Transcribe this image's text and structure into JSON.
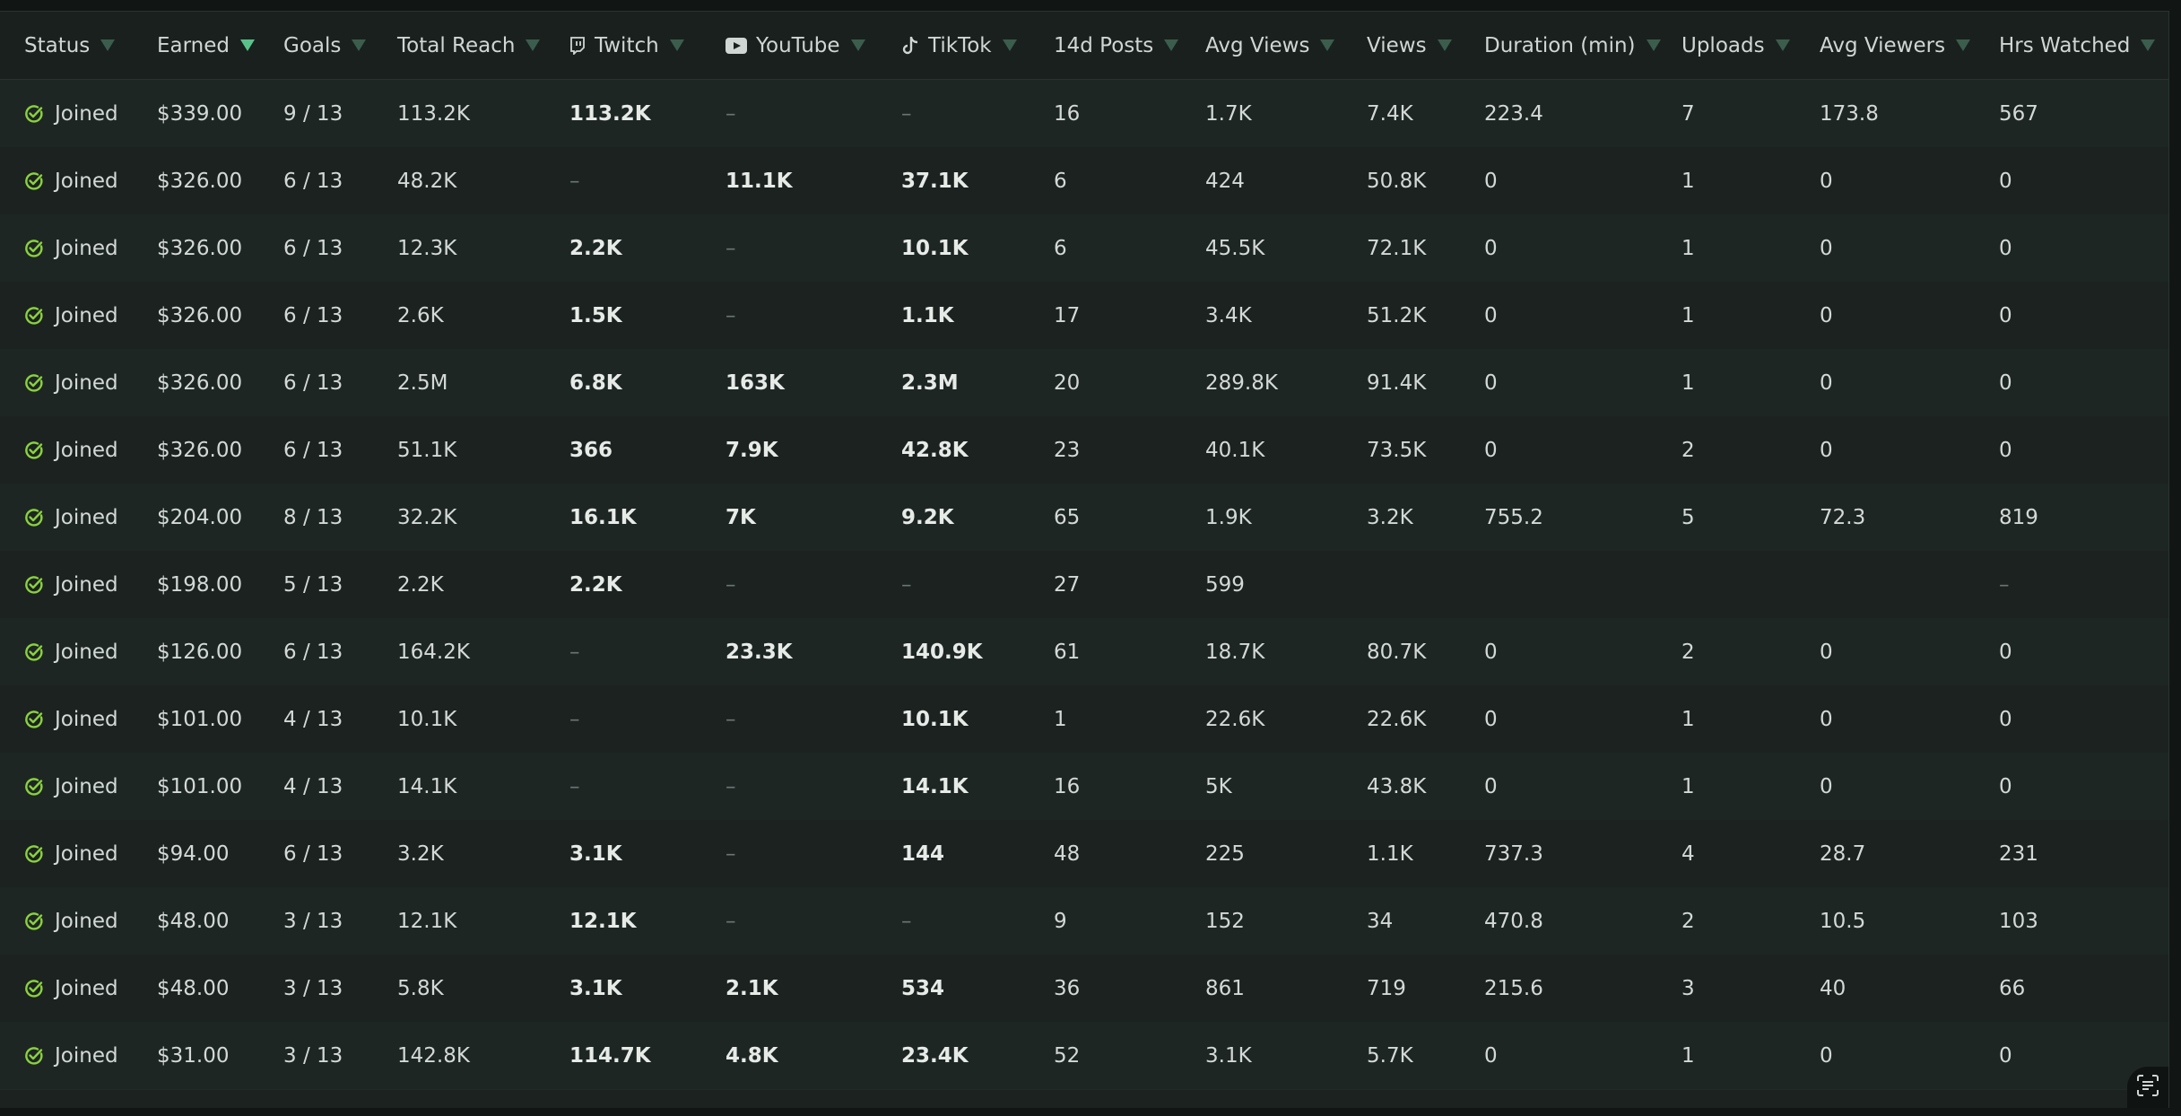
{
  "colors": {
    "background": "#1b2220",
    "accent_green": "#8ad13f",
    "sort_arrow": "#3b5d4e",
    "sort_arrow_active": "#59c28b",
    "dash": "#6b7673"
  },
  "columns": [
    {
      "key": "status",
      "label": "Status",
      "sort_icon": "sort-arrow-icon"
    },
    {
      "key": "earned",
      "label": "Earned",
      "sort_icon": "sort-arrow-icon",
      "active": true
    },
    {
      "key": "goals",
      "label": "Goals",
      "sort_icon": "sort-arrow-icon"
    },
    {
      "key": "total_reach",
      "label": "Total Reach",
      "sort_icon": "sort-arrow-icon"
    },
    {
      "key": "twitch",
      "label": "Twitch",
      "sort_icon": "sort-arrow-icon",
      "platform_icon": "twitch-icon"
    },
    {
      "key": "youtube",
      "label": "YouTube",
      "sort_icon": "sort-arrow-icon",
      "platform_icon": "youtube-icon"
    },
    {
      "key": "tiktok",
      "label": "TikTok",
      "sort_icon": "sort-arrow-icon",
      "platform_icon": "tiktok-icon"
    },
    {
      "key": "posts14",
      "label": "14d Posts",
      "sort_icon": "sort-arrow-icon"
    },
    {
      "key": "avg_views",
      "label": "Avg Views",
      "sort_icon": "sort-arrow-icon"
    },
    {
      "key": "views",
      "label": "Views",
      "sort_icon": "sort-arrow-icon"
    },
    {
      "key": "duration",
      "label": "Duration (min)",
      "sort_icon": "sort-arrow-icon"
    },
    {
      "key": "uploads",
      "label": "Uploads",
      "sort_icon": "sort-arrow-icon"
    },
    {
      "key": "avg_viewers",
      "label": "Avg Viewers",
      "sort_icon": "sort-arrow-icon"
    },
    {
      "key": "hrs_watched",
      "label": "Hrs Watched",
      "sort_icon": "sort-arrow-icon"
    }
  ],
  "rows": [
    {
      "status": "Joined",
      "earned": "$339.00",
      "goals": "9 / 13",
      "total_reach": "113.2K",
      "twitch": "113.2K",
      "youtube": "–",
      "tiktok": "–",
      "posts14": "16",
      "avg_views": "1.7K",
      "views": "7.4K",
      "duration": "223.4",
      "uploads": "7",
      "avg_viewers": "173.8",
      "hrs_watched": "567"
    },
    {
      "status": "Joined",
      "earned": "$326.00",
      "goals": "6 / 13",
      "total_reach": "48.2K",
      "twitch": "–",
      "youtube": "11.1K",
      "tiktok": "37.1K",
      "posts14": "6",
      "avg_views": "424",
      "views": "50.8K",
      "duration": "0",
      "uploads": "1",
      "avg_viewers": "0",
      "hrs_watched": "0"
    },
    {
      "status": "Joined",
      "earned": "$326.00",
      "goals": "6 / 13",
      "total_reach": "12.3K",
      "twitch": "2.2K",
      "youtube": "–",
      "tiktok": "10.1K",
      "posts14": "6",
      "avg_views": "45.5K",
      "views": "72.1K",
      "duration": "0",
      "uploads": "1",
      "avg_viewers": "0",
      "hrs_watched": "0"
    },
    {
      "status": "Joined",
      "earned": "$326.00",
      "goals": "6 / 13",
      "total_reach": "2.6K",
      "twitch": "1.5K",
      "youtube": "–",
      "tiktok": "1.1K",
      "posts14": "17",
      "avg_views": "3.4K",
      "views": "51.2K",
      "duration": "0",
      "uploads": "1",
      "avg_viewers": "0",
      "hrs_watched": "0"
    },
    {
      "status": "Joined",
      "earned": "$326.00",
      "goals": "6 / 13",
      "total_reach": "2.5M",
      "twitch": "6.8K",
      "youtube": "163K",
      "tiktok": "2.3M",
      "posts14": "20",
      "avg_views": "289.8K",
      "views": "91.4K",
      "duration": "0",
      "uploads": "1",
      "avg_viewers": "0",
      "hrs_watched": "0"
    },
    {
      "status": "Joined",
      "earned": "$326.00",
      "goals": "6 / 13",
      "total_reach": "51.1K",
      "twitch": "366",
      "youtube": "7.9K",
      "tiktok": "42.8K",
      "posts14": "23",
      "avg_views": "40.1K",
      "views": "73.5K",
      "duration": "0",
      "uploads": "2",
      "avg_viewers": "0",
      "hrs_watched": "0"
    },
    {
      "status": "Joined",
      "earned": "$204.00",
      "goals": "8 / 13",
      "total_reach": "32.2K",
      "twitch": "16.1K",
      "youtube": "7K",
      "tiktok": "9.2K",
      "posts14": "65",
      "avg_views": "1.9K",
      "views": "3.2K",
      "duration": "755.2",
      "uploads": "5",
      "avg_viewers": "72.3",
      "hrs_watched": "819"
    },
    {
      "status": "Joined",
      "earned": "$198.00",
      "goals": "5 / 13",
      "total_reach": "2.2K",
      "twitch": "2.2K",
      "youtube": "–",
      "tiktok": "–",
      "posts14": "27",
      "avg_views": "599",
      "views": "",
      "duration": "",
      "uploads": "",
      "avg_viewers": "",
      "hrs_watched": "–"
    },
    {
      "status": "Joined",
      "earned": "$126.00",
      "goals": "6 / 13",
      "total_reach": "164.2K",
      "twitch": "–",
      "youtube": "23.3K",
      "tiktok": "140.9K",
      "posts14": "61",
      "avg_views": "18.7K",
      "views": "80.7K",
      "duration": "0",
      "uploads": "2",
      "avg_viewers": "0",
      "hrs_watched": "0"
    },
    {
      "status": "Joined",
      "earned": "$101.00",
      "goals": "4 / 13",
      "total_reach": "10.1K",
      "twitch": "–",
      "youtube": "–",
      "tiktok": "10.1K",
      "posts14": "1",
      "avg_views": "22.6K",
      "views": "22.6K",
      "duration": "0",
      "uploads": "1",
      "avg_viewers": "0",
      "hrs_watched": "0"
    },
    {
      "status": "Joined",
      "earned": "$101.00",
      "goals": "4 / 13",
      "total_reach": "14.1K",
      "twitch": "–",
      "youtube": "–",
      "tiktok": "14.1K",
      "posts14": "16",
      "avg_views": "5K",
      "views": "43.8K",
      "duration": "0",
      "uploads": "1",
      "avg_viewers": "0",
      "hrs_watched": "0"
    },
    {
      "status": "Joined",
      "earned": "$94.00",
      "goals": "6 / 13",
      "total_reach": "3.2K",
      "twitch": "3.1K",
      "youtube": "–",
      "tiktok": "144",
      "posts14": "48",
      "avg_views": "225",
      "views": "1.1K",
      "duration": "737.3",
      "uploads": "4",
      "avg_viewers": "28.7",
      "hrs_watched": "231"
    },
    {
      "status": "Joined",
      "earned": "$48.00",
      "goals": "3 / 13",
      "total_reach": "12.1K",
      "twitch": "12.1K",
      "youtube": "–",
      "tiktok": "–",
      "posts14": "9",
      "avg_views": "152",
      "views": "34",
      "duration": "470.8",
      "uploads": "2",
      "avg_viewers": "10.5",
      "hrs_watched": "103"
    },
    {
      "status": "Joined",
      "earned": "$48.00",
      "goals": "3 / 13",
      "total_reach": "5.8K",
      "twitch": "3.1K",
      "youtube": "2.1K",
      "tiktok": "534",
      "posts14": "36",
      "avg_views": "861",
      "views": "719",
      "duration": "215.6",
      "uploads": "3",
      "avg_viewers": "40",
      "hrs_watched": "66"
    },
    {
      "status": "Joined",
      "earned": "$31.00",
      "goals": "3 / 13",
      "total_reach": "142.8K",
      "twitch": "114.7K",
      "youtube": "4.8K",
      "tiktok": "23.4K",
      "posts14": "52",
      "avg_views": "3.1K",
      "views": "5.7K",
      "duration": "0",
      "uploads": "1",
      "avg_viewers": "0",
      "hrs_watched": "0"
    }
  ],
  "corner_button_icon": "scan-text-icon"
}
